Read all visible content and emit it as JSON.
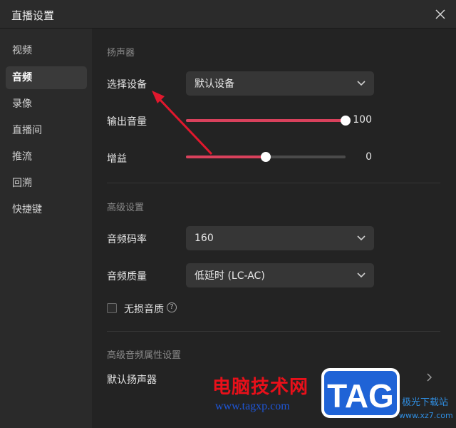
{
  "window": {
    "title": "直播设置"
  },
  "sidebar": {
    "items": [
      {
        "label": "视频"
      },
      {
        "label": "音频"
      },
      {
        "label": "录像"
      },
      {
        "label": "直播间"
      },
      {
        "label": "推流"
      },
      {
        "label": "回溯"
      },
      {
        "label": "快捷键"
      }
    ],
    "active": "音频"
  },
  "speaker": {
    "section": "扬声器",
    "device_label": "选择设备",
    "device_value": "默认设备",
    "volume_label": "输出音量",
    "volume_value": "100",
    "volume_level": 100,
    "gain_label": "增益",
    "gain_value": "0",
    "gain_level": 50
  },
  "advanced": {
    "section": "高级设置",
    "bitrate_label": "音频码率",
    "bitrate_value": "160",
    "quality_label": "音频质量",
    "quality_value": "低延时 (LC-AC)",
    "lossless_label": "无损音质",
    "lossless_checked": false
  },
  "audio_props": {
    "section": "高级音频属性设置",
    "default_speaker_label": "默认扬声器"
  },
  "watermark": {
    "site_name": "电脑技术网",
    "site_url": "www.tagxp.com",
    "logo_text": "TAG",
    "dl_name": "极光下载站",
    "dl_url": "www.xz7.com"
  },
  "colors": {
    "accent": "#d9415c",
    "annotation_arrow": "#e0182d",
    "background": "#232323",
    "sidebar": "#2a2a2a"
  }
}
